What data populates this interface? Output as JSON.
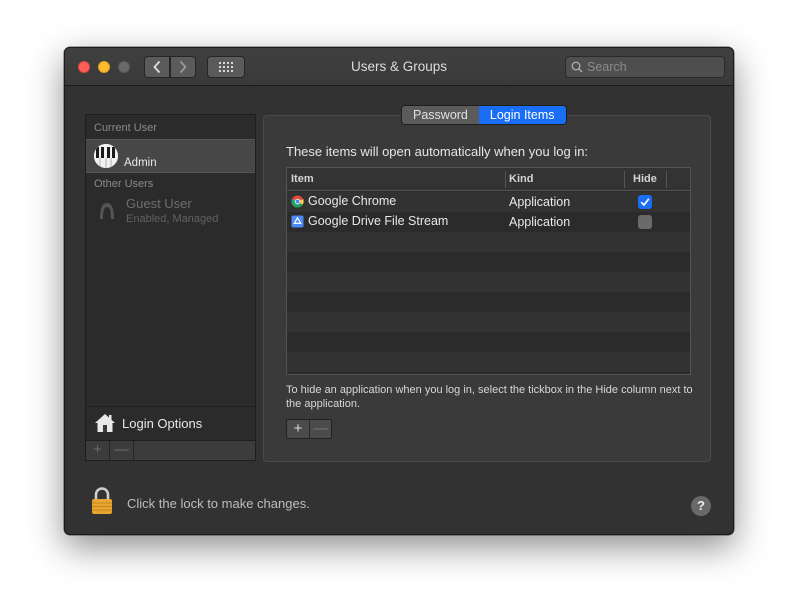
{
  "window": {
    "title": "Users & Groups",
    "search_placeholder": "Search"
  },
  "sidebar": {
    "current_user_header": "Current User",
    "current_user": {
      "name": "Admin"
    },
    "other_users_header": "Other Users",
    "other_users": [
      {
        "name": "Guest User",
        "subtitle": "Enabled, Managed"
      }
    ],
    "login_options_label": "Login Options",
    "add_label": "+",
    "remove_label": "—"
  },
  "tabs": [
    {
      "label": "Password",
      "active": false
    },
    {
      "label": "Login Items",
      "active": true
    }
  ],
  "login_items": {
    "heading": "These items will open automatically when you log in:",
    "columns": {
      "item": "Item",
      "kind": "Kind",
      "hide": "Hide"
    },
    "rows": [
      {
        "item": "Google Chrome",
        "kind": "Application",
        "hide": true,
        "icon": "chrome-icon"
      },
      {
        "item": "Google Drive File Stream",
        "kind": "Application",
        "hide": false,
        "icon": "google-drive-icon"
      }
    ],
    "note": "To hide an application when you log in, select the tickbox in the Hide column next to the application.",
    "add_label": "+",
    "remove_label": "—"
  },
  "footer": {
    "lock_text": "Click the lock to make changes.",
    "help_label": "?"
  },
  "colors": {
    "accent": "#1a6ef5",
    "window_bg": "#323232",
    "lock": "#e8a531"
  }
}
